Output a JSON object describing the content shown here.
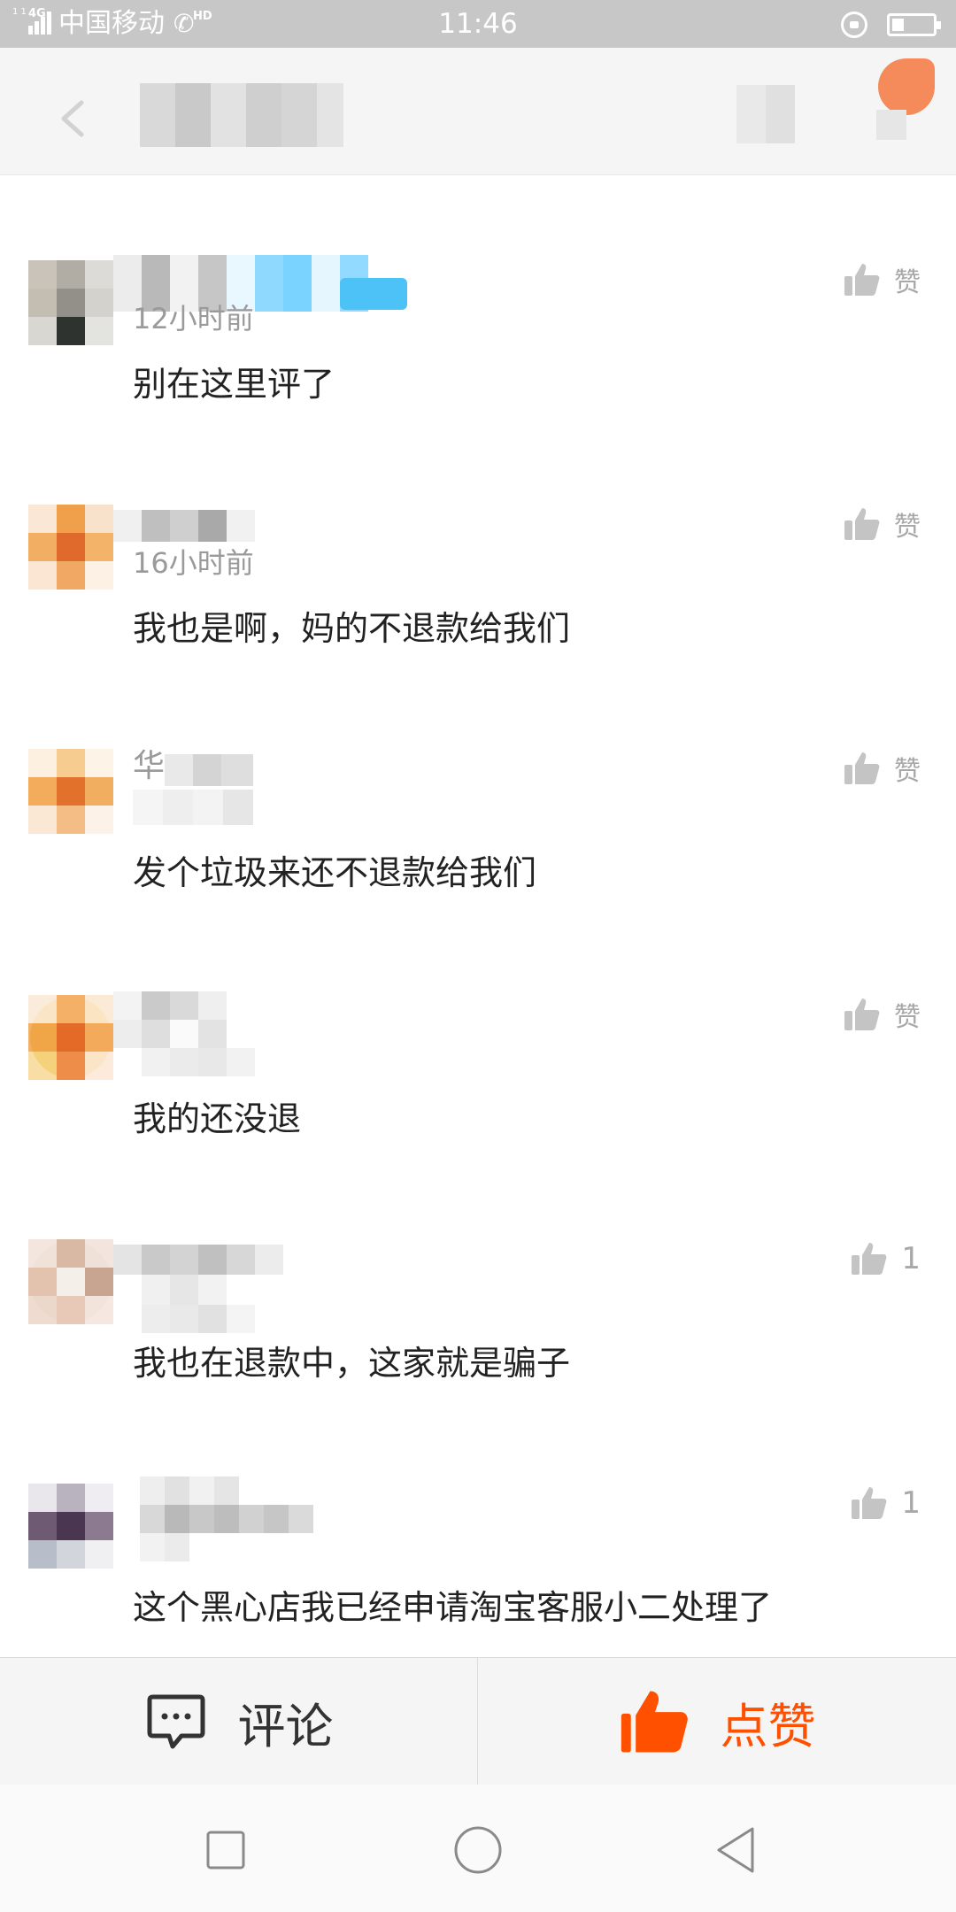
{
  "status_bar": {
    "mini_text": "1 1",
    "network": "4G",
    "carrier": "中国移动",
    "call_badge": "HD",
    "time": "11:46",
    "battery_level": 0.3
  },
  "header": {
    "back_icon": "chevron-left-icon"
  },
  "comments": [
    {
      "time": "12小时前",
      "text": "别在这里评了",
      "like_label": "赞",
      "like_count": ""
    },
    {
      "time": "16小时前",
      "text": "我也是啊，妈的不退款给我们",
      "like_label": "赞",
      "like_count": ""
    },
    {
      "time": "",
      "name_fragment": "华",
      "text": "发个垃圾来还不退款给我们",
      "like_label": "赞",
      "like_count": ""
    },
    {
      "time": "",
      "text": "我的还没退",
      "like_label": "赞",
      "like_count": ""
    },
    {
      "time": "",
      "text": "我也在退款中，这家就是骗子",
      "like_label": "",
      "like_count": "1"
    },
    {
      "time": "",
      "text": "这个黑心店我已经申请淘宝客服小二处理了",
      "like_label": "",
      "like_count": "1"
    }
  ],
  "action_bar": {
    "comment_label": "评论",
    "like_label": "点赞",
    "like_color": "#ff5000"
  },
  "colors": {
    "status_bar_bg": "#c7c7c7",
    "header_bg": "#f5f5f5",
    "muted_text": "#9a9a9a"
  },
  "nav": {
    "recent_icon": "square-icon",
    "home_icon": "circle-icon",
    "back_icon": "triangle-back-icon"
  }
}
